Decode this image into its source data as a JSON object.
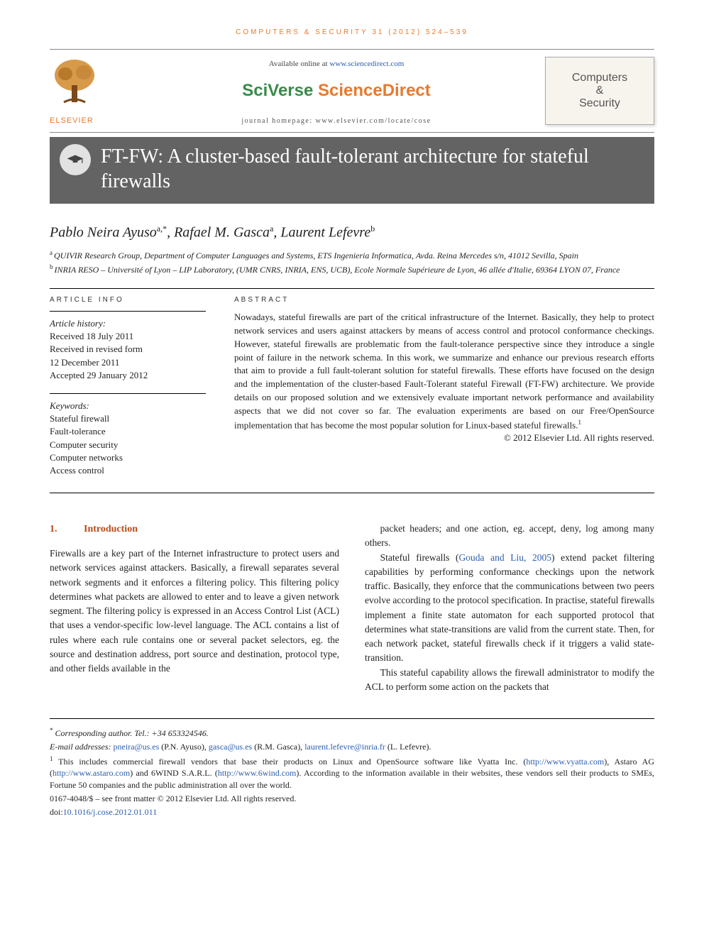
{
  "running_head": "computers & security 31 (2012) 524–539",
  "header": {
    "available_text": "Available online at ",
    "available_link": "www.sciencedirect.com",
    "sciverse_a": "SciVerse ",
    "sciverse_b": "ScienceDirect",
    "journal_home": "journal homepage: www.elsevier.com/locate/cose",
    "publisher": "ELSEVIER",
    "journal_title_1": "Computers",
    "journal_title_amp": "&",
    "journal_title_2": "Security"
  },
  "title": "FT-FW: A cluster-based fault-tolerant architecture for stateful firewalls",
  "authors_line": "Pablo Neira Ayuso",
  "authors": {
    "a1_name": "Pablo Neira Ayuso",
    "a1_sup": "a,*",
    "a2_name": "Rafael M. Gasca",
    "a2_sup": "a",
    "a3_name": "Laurent Lefevre",
    "a3_sup": "b"
  },
  "affiliations": {
    "a_sup": "a",
    "a_text": "QUIVIR Research Group, Department of Computer Languages and Systems, ETS Ingenieria Informatica, Avda. Reina Mercedes s/n, 41012 Sevilla, Spain",
    "b_sup": "b",
    "b_text": "INRIA RESO – Université of Lyon – LIP Laboratory, (UMR CNRS, INRIA, ENS, UCB), Ecole Normale Supérieure de Lyon, 46 allée d'Italie, 69364 LYON 07, France"
  },
  "article_info": {
    "head": "ARTICLE INFO",
    "history_label": "Article history:",
    "received": "Received 18 July 2011",
    "revised1": "Received in revised form",
    "revised2": "12 December 2011",
    "accepted": "Accepted 29 January 2012",
    "keywords_label": "Keywords:",
    "keywords": [
      "Stateful firewall",
      "Fault-tolerance",
      "Computer security",
      "Computer networks",
      "Access control"
    ]
  },
  "abstract": {
    "head": "ABSTRACT",
    "text": "Nowadays, stateful firewalls are part of the critical infrastructure of the Internet. Basically, they help to protect network services and users against attackers by means of access control and protocol conformance checkings. However, stateful firewalls are problematic from the fault-tolerance perspective since they introduce a single point of failure in the network schema. In this work, we summarize and enhance our previous research efforts that aim to provide a full fault-tolerant solution for stateful firewalls. These efforts have focused on the design and the implementation of the cluster-based Fault-Tolerant stateful Firewall (FT-FW) architecture. We provide details on our proposed solution and we extensively evaluate important network performance and availability aspects that we did not cover so far. The evaluation experiments are based on our Free/OpenSource implementation that has become the most popular solution for Linux-based stateful firewalls.",
    "foot_sup": "1",
    "copyright": "© 2012 Elsevier Ltd. All rights reserved."
  },
  "body": {
    "section_num": "1.",
    "section_title": "Introduction",
    "p1": "Firewalls are a key part of the Internet infrastructure to protect users and network services against attackers. Basically, a firewall separates several network segments and it enforces a filtering policy. This filtering policy determines what packets are allowed to enter and to leave a given network segment. The filtering policy is expressed in an Access Control List (ACL) that uses a vendor-specific low-level language. The ACL contains a list of rules where each rule contains one or several packet selectors, eg. the source and destination address, port source and destination, protocol type, and other fields available in the",
    "p2_a": "packet headers; and one action, eg. accept, deny, log among many others.",
    "p2_b_pre": "Stateful firewalls (",
    "p2_b_link": "Gouda and Liu, 2005",
    "p2_b_post": ") extend packet filtering capabilities by performing conformance checkings upon the network traffic. Basically, they enforce that the communications between two peers evolve according to the protocol specification. In practise, stateful firewalls implement a finite state automaton for each supported protocol that determines what state-transitions are valid from the current state. Then, for each network packet, stateful firewalls check if it triggers a valid state-transition.",
    "p3": "This stateful capability allows the firewall administrator to modify the ACL to perform some action on the packets that"
  },
  "footnotes": {
    "corr_sup": "*",
    "corr_text": "Corresponding author. Tel.: +34 653324546.",
    "emails_label": "E-mail addresses: ",
    "email1": "pneira@us.es",
    "email1_who": " (P.N. Ayuso), ",
    "email2": "gasca@us.es",
    "email2_who": " (R.M. Gasca), ",
    "email3": "laurent.lefevre@inria.fr",
    "email3_who": " (L. Lefevre).",
    "note1_sup": "1",
    "note1_a": " This includes commercial firewall vendors that base their products on Linux and OpenSource software like Vyatta Inc. (",
    "note1_link1": "http://www.vyatta.com",
    "note1_b": "), Astaro AG (",
    "note1_link2": "http://www.astaro.com",
    "note1_c": ") and 6WIND S.A.R.L. (",
    "note1_link3": "http://www.6wind.com",
    "note1_d": "). According to the information available in their websites, these vendors sell their products to SMEs, Fortune 50 companies and the public administration all over the world.",
    "front_matter": "0167-4048/$ – see front matter © 2012 Elsevier Ltd. All rights reserved.",
    "doi_label": "doi:",
    "doi": "10.1016/j.cose.2012.01.011"
  }
}
